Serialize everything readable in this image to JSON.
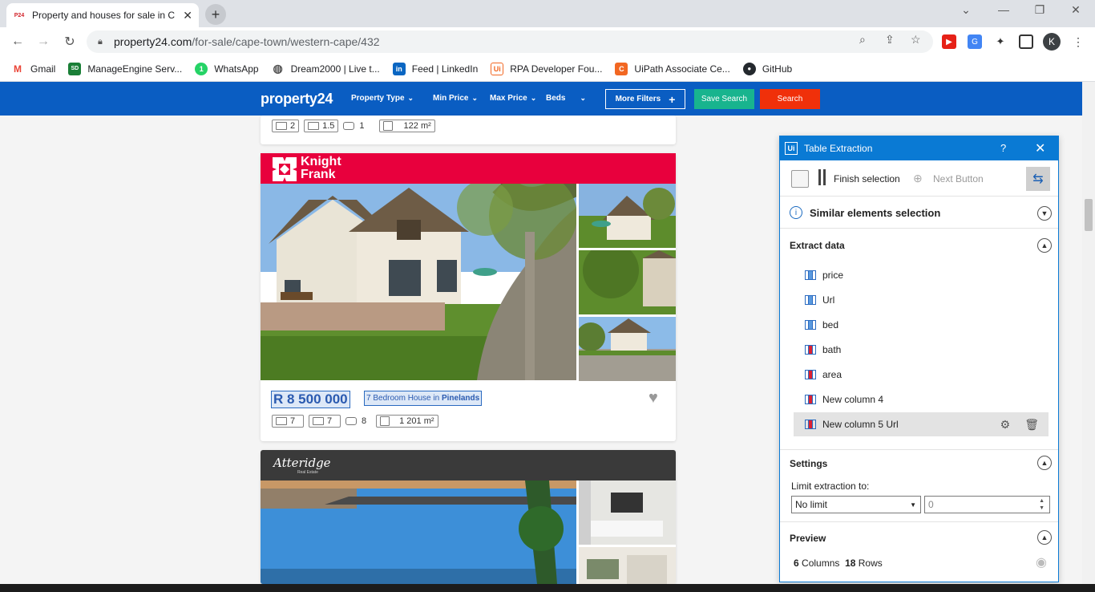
{
  "browser": {
    "tab_title": "Property and houses for sale in C",
    "favicon_text": "P24",
    "url_domain": "property24.com",
    "url_path": "/for-sale/cape-town/western-cape/432",
    "avatar_letter": "K"
  },
  "bookmarks": [
    {
      "label": "Gmail",
      "icon": "gmail-icon",
      "icon_text": "M",
      "color": "#ea4335"
    },
    {
      "label": "ManageEngine Serv...",
      "icon": "manageengine-icon",
      "icon_text": "SD",
      "color": "#1a7f37"
    },
    {
      "label": "WhatsApp",
      "icon": "whatsapp-icon",
      "icon_text": "1",
      "color": "#25d366"
    },
    {
      "label": "Dream2000 | Live t...",
      "icon": "globe-icon",
      "icon_text": "◍",
      "color": "#555555"
    },
    {
      "label": "Feed | LinkedIn",
      "icon": "linkedin-icon",
      "icon_text": "in",
      "color": "#0a66c2"
    },
    {
      "label": "RPA Developer Fou...",
      "icon": "uipath-icon",
      "icon_text": "Ui",
      "color": "#f26722"
    },
    {
      "label": "UiPath Associate Ce...",
      "icon": "uipath-c-icon",
      "icon_text": "C",
      "color": "#f26722"
    },
    {
      "label": "GitHub",
      "icon": "github-icon",
      "icon_text": "●",
      "color": "#24292e"
    }
  ],
  "site": {
    "logo": "property24",
    "nav": [
      "Property Type",
      "Min Price",
      "Max Price",
      "Beds"
    ],
    "more_filters": "More Filters",
    "save_search": "Save Search",
    "search": "Search",
    "brand_color": "#0a5dc2"
  },
  "listings": {
    "first": {
      "beds": "2",
      "baths": "1.5",
      "garages": "1",
      "area": "122 m²"
    },
    "second": {
      "agency_line1": "Knight",
      "agency_line2": "Frank",
      "price": "R 8 500 000",
      "title_prefix": "7 Bedroom House in ",
      "title_suburb": "Pinelands",
      "beds": "7",
      "baths": "7",
      "garages": "8",
      "area": "1 201 m²"
    },
    "third": {
      "agency": "Atteridge",
      "agency_sub": "Real Estate"
    }
  },
  "panel": {
    "title": "Table Extraction",
    "help": "?",
    "finish_selection": "Finish selection",
    "next_button": "Next Button",
    "similar_elements": "Similar elements selection",
    "extract_data": "Extract data",
    "columns": [
      {
        "label": "price",
        "variant": "blue"
      },
      {
        "label": "Url",
        "variant": "blue"
      },
      {
        "label": "bed",
        "variant": "blue"
      },
      {
        "label": "bath",
        "variant": "red"
      },
      {
        "label": "area",
        "variant": "red"
      },
      {
        "label": "New column 4",
        "variant": "red"
      },
      {
        "label": "New column 5 Url",
        "variant": "red"
      }
    ],
    "settings": "Settings",
    "limit_label": "Limit extraction to:",
    "limit_value": "No limit",
    "limit_number": "0",
    "preview": "Preview",
    "columns_count": "6",
    "columns_word": "Columns",
    "rows_count": "18",
    "rows_word": "Rows"
  }
}
